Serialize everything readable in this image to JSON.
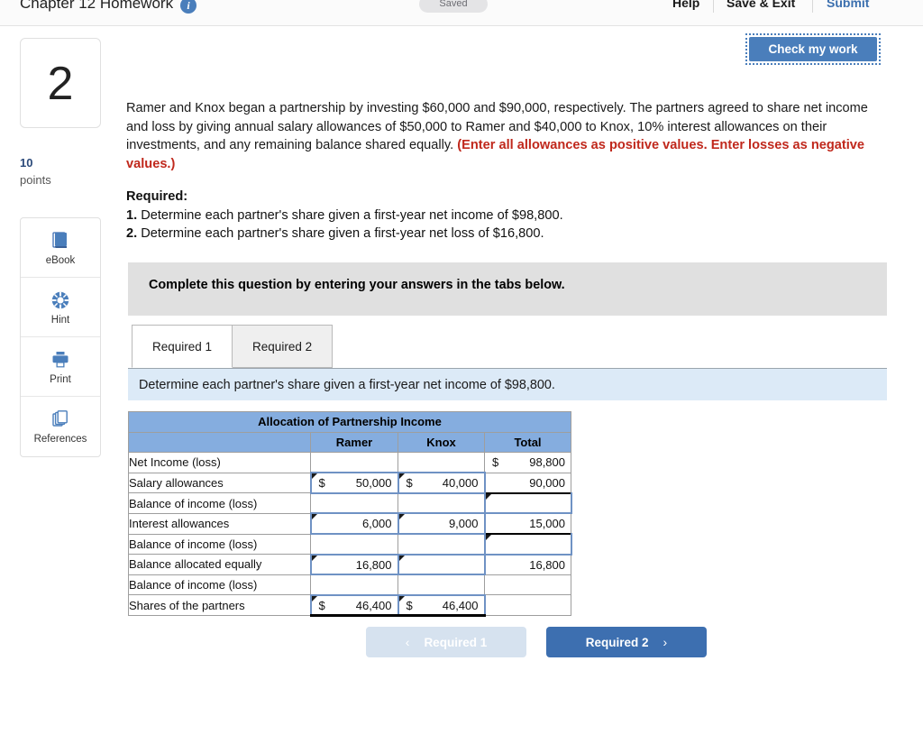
{
  "header": {
    "title": "Chapter 12 Homework",
    "info_icon": "info-circle-icon",
    "saved_badge": "Saved",
    "help": "Help",
    "save_exit": "Save & Exit",
    "submit": "Submit",
    "check_my_work": "Check my work",
    "accent_color": "#4a7ebb"
  },
  "sidebar": {
    "question_number": "2",
    "points_value": "10",
    "points_label": "points",
    "tools": [
      {
        "label": "eBook",
        "icon": "book-icon"
      },
      {
        "label": "Hint",
        "icon": "lifebuoy-icon"
      },
      {
        "label": "Print",
        "icon": "printer-icon"
      },
      {
        "label": "References",
        "icon": "pages-stack-icon"
      }
    ]
  },
  "problem": {
    "paragraph_part1": "Ramer and Knox began a partnership by investing $60,000 and $90,000, respectively. The partners agreed to share net income and loss by giving annual salary allowances of $50,000 to Ramer and $40,000 to Knox, 10% interest allowances on their investments, and any remaining balance shared equally. ",
    "paragraph_warning": "(Enter all allowances as positive values. Enter losses as negative values.)",
    "required_heading": "Required:",
    "req1_num": "1.",
    "req1_text": " Determine each partner's share given a first-year net income of $98,800.",
    "req2_num": "2.",
    "req2_text": " Determine each partner's share given a first-year net loss of $16,800."
  },
  "instruction_panel": {
    "text": "Complete this question by entering your answers in the tabs below."
  },
  "tabs": [
    {
      "label": "Required 1",
      "active": true
    },
    {
      "label": "Required 2",
      "active": false
    }
  ],
  "tab_instruction": "Determine each partner's share given a first-year net income of $98,800.",
  "table": {
    "title": "Allocation of Partnership Income",
    "columns": [
      "",
      "Ramer",
      "Knox",
      "Total"
    ],
    "header_color": "#85addf",
    "rows": [
      {
        "label": "Net Income (loss)",
        "ramer": {
          "currency": "",
          "amount": ""
        },
        "knox": {
          "currency": "",
          "amount": ""
        },
        "total": {
          "currency": "$",
          "amount": "98,800"
        }
      },
      {
        "label": "Salary allowances",
        "ramer": {
          "currency": "$",
          "amount": "50,000"
        },
        "knox": {
          "currency": "$",
          "amount": "40,000"
        },
        "total": {
          "currency": "",
          "amount": "90,000"
        }
      },
      {
        "label": "Balance of income (loss)",
        "ramer": {
          "currency": "",
          "amount": ""
        },
        "knox": {
          "currency": "",
          "amount": ""
        },
        "total": {
          "currency": "",
          "amount": ""
        }
      },
      {
        "label": "Interest allowances",
        "ramer": {
          "currency": "",
          "amount": "6,000"
        },
        "knox": {
          "currency": "",
          "amount": "9,000"
        },
        "total": {
          "currency": "",
          "amount": "15,000"
        }
      },
      {
        "label": "Balance of income (loss)",
        "ramer": {
          "currency": "",
          "amount": ""
        },
        "knox": {
          "currency": "",
          "amount": ""
        },
        "total": {
          "currency": "",
          "amount": ""
        }
      },
      {
        "label": "Balance allocated equally",
        "ramer": {
          "currency": "",
          "amount": "16,800"
        },
        "knox": {
          "currency": "",
          "amount": ""
        },
        "total": {
          "currency": "",
          "amount": "16,800"
        }
      },
      {
        "label": "Balance of income (loss)",
        "ramer": {
          "currency": "",
          "amount": ""
        },
        "knox": {
          "currency": "",
          "amount": ""
        },
        "total": {
          "currency": "",
          "amount": ""
        }
      },
      {
        "label": "Shares of the partners",
        "ramer": {
          "currency": "$",
          "amount": "46,400"
        },
        "knox": {
          "currency": "$",
          "amount": "46,400"
        },
        "total": {
          "currency": "",
          "amount": ""
        }
      }
    ]
  },
  "nav": {
    "prev_label": "Required 1",
    "prev_chevron": "‹",
    "next_label": "Required 2",
    "next_chevron": "›"
  }
}
